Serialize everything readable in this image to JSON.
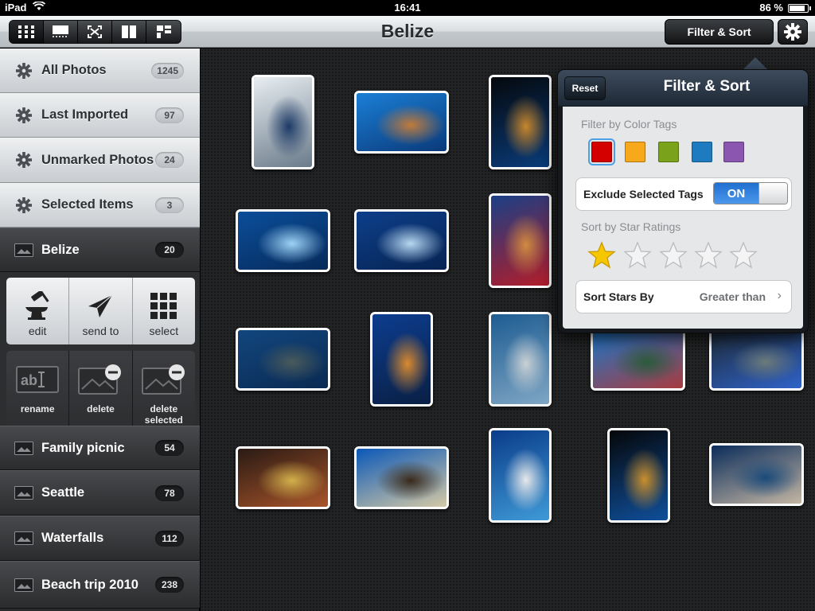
{
  "status": {
    "device": "iPad",
    "time": "16:41",
    "battery": "86 %"
  },
  "navbar": {
    "title": "Belize",
    "filter_button": "Filter & Sort",
    "view_modes": [
      "grid-view-icon",
      "list-view-icon",
      "fullscreen-view-icon",
      "split-view-icon",
      "mosaic-view-icon"
    ]
  },
  "sidebar": {
    "smart_albums": [
      {
        "label": "All Photos",
        "count": "1245"
      },
      {
        "label": "Last Imported",
        "count": "97"
      },
      {
        "label": "Unmarked Photos",
        "count": "24"
      },
      {
        "label": "Selected Items",
        "count": "3"
      }
    ],
    "current_album": {
      "label": "Belize",
      "count": "20"
    },
    "actions_primary": [
      {
        "label": "edit",
        "icon": "anvil-hammer-icon"
      },
      {
        "label": "send to",
        "icon": "paper-plane-icon"
      },
      {
        "label": "select",
        "icon": "grid-select-icon"
      }
    ],
    "actions_secondary": [
      {
        "label": "rename",
        "icon": "rename-icon"
      },
      {
        "label": "delete",
        "icon": "delete-album-icon"
      },
      {
        "label": "delete selected",
        "icon": "delete-selected-icon"
      }
    ],
    "albums": [
      {
        "label": "Family picnic",
        "count": "54"
      },
      {
        "label": "Seattle",
        "count": "78"
      },
      {
        "label": "Waterfalls",
        "count": "112"
      },
      {
        "label": "Beach trip 2010",
        "count": "238"
      }
    ]
  },
  "popover": {
    "reset": "Reset",
    "title": "Filter & Sort",
    "color_tags_label": "Filter by Color Tags",
    "color_tags": [
      "#d40000",
      "#f7a81b",
      "#7aa21a",
      "#1e7bbf",
      "#8a56b0"
    ],
    "selected_color_tag": "#d40000",
    "exclude_label": "Exclude Selected Tags",
    "exclude_value": "ON",
    "star_label": "Sort by Star Ratings",
    "star_rating": 1,
    "star_max": 5,
    "sort_by_label": "Sort Stars By",
    "sort_by_value": "Greater than"
  },
  "photos": [
    {
      "subject": "dive-boat",
      "colors": [
        "#e8eef2",
        "#6b7b8a",
        "#1d3a66"
      ]
    },
    {
      "subject": "coral-reef",
      "colors": [
        "#1b7fd6",
        "#0a3a7a",
        "#c07a3a"
      ]
    },
    {
      "subject": "orange-sponge",
      "colors": [
        "#05080c",
        "#0a3c7a",
        "#c7862c"
      ]
    },
    {
      "subject": "manta-ray",
      "colors": [
        "#0b4e9a",
        "#062a5a",
        "#9fd3f5"
      ]
    },
    {
      "subject": "manta-ray-2",
      "colors": [
        "#0d3e8a",
        "#072452",
        "#b8d8f0"
      ]
    },
    {
      "subject": "red-coral-wall",
      "colors": [
        "#1a3f86",
        "#b21d2a",
        "#d18a40"
      ]
    },
    {
      "subject": "grouper",
      "colors": [
        "#12467e",
        "#0a2a52",
        "#4a5a5a"
      ]
    },
    {
      "subject": "sponge-wall",
      "colors": [
        "#0c3d8f",
        "#0a1f44",
        "#d98a2e"
      ]
    },
    {
      "subject": "jawfish",
      "colors": [
        "#1d5c92",
        "#7fa6c4",
        "#c9d0d4"
      ]
    },
    {
      "subject": "reef-scene",
      "colors": [
        "#1a78cc",
        "#a83b3e",
        "#2a5a3a"
      ]
    },
    {
      "subject": "blue-fish",
      "colors": [
        "#1d2a38",
        "#2f63c9",
        "#6b7a7a"
      ]
    },
    {
      "subject": "moray-eel",
      "colors": [
        "#2a1a14",
        "#a8552a",
        "#d3b04a"
      ]
    },
    {
      "subject": "sea-turtle",
      "colors": [
        "#0b58b8",
        "#d5c9a5",
        "#3a2a1a"
      ]
    },
    {
      "subject": "sea-fan",
      "colors": [
        "#0a3c8a",
        "#3f9ad6",
        "#e8e8ea"
      ]
    },
    {
      "subject": "sponge-dark",
      "colors": [
        "#05070a",
        "#0f4f9a",
        "#c98f2e"
      ]
    },
    {
      "subject": "angelfish",
      "colors": [
        "#0a2c5a",
        "#c4b6a4",
        "#1a4a7a"
      ]
    }
  ]
}
